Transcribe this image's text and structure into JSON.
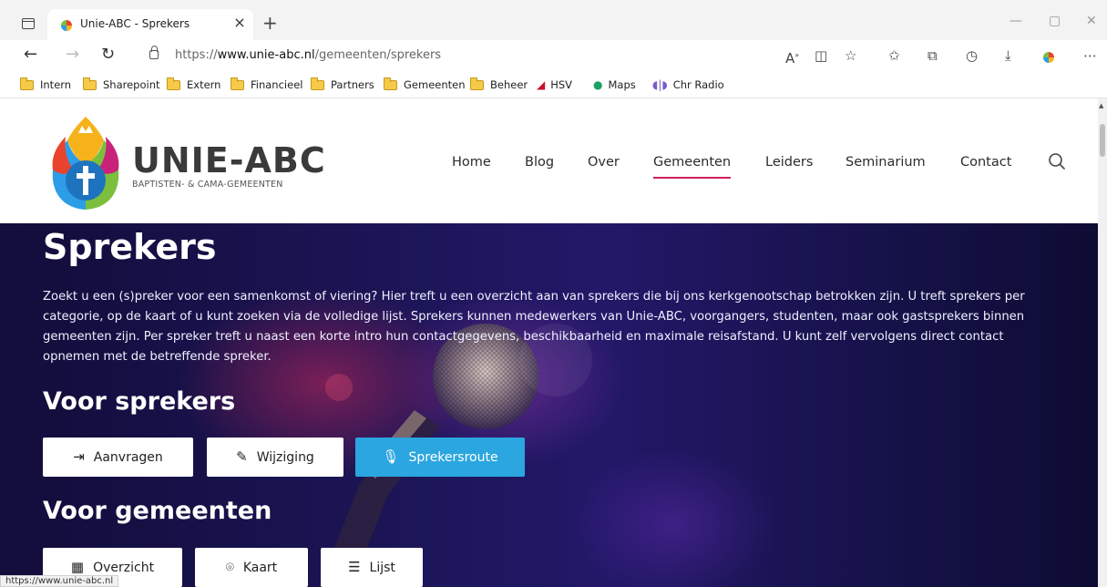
{
  "browser": {
    "tab_title": "Unie-ABC - Sprekers",
    "url_prefix": "https://",
    "url_host": "www.unie-abc.nl",
    "url_path": "/gemeenten/sprekers",
    "bookmarks": [
      {
        "label": "Intern",
        "icon": "folder-icon"
      },
      {
        "label": "Sharepoint",
        "icon": "folder-icon"
      },
      {
        "label": "Extern",
        "icon": "folder-icon"
      },
      {
        "label": "Financieel",
        "icon": "folder-icon"
      },
      {
        "label": "Partners",
        "icon": "folder-icon"
      },
      {
        "label": "Gemeenten",
        "icon": "folder-icon"
      },
      {
        "label": "Beheer",
        "icon": "folder-icon"
      },
      {
        "label": "HSV",
        "icon": "hsv-icon"
      },
      {
        "label": "Maps",
        "icon": "maps-pin-icon"
      },
      {
        "label": "Chr Radio",
        "icon": "radio-icon"
      }
    ],
    "status_url": "https://www.unie-abc.nl"
  },
  "header": {
    "brand": "UNIE-ABC",
    "brand_sub": "BAPTISTEN- & CAMA-GEMEENTEN",
    "nav": [
      {
        "label": "Home",
        "active": false
      },
      {
        "label": "Blog",
        "active": false
      },
      {
        "label": "Over",
        "active": false
      },
      {
        "label": "Gemeenten",
        "active": true
      },
      {
        "label": "Leiders",
        "active": false
      },
      {
        "label": "Seminarium",
        "active": false
      },
      {
        "label": "Contact",
        "active": false
      }
    ],
    "accent": "#d2215a"
  },
  "hero": {
    "title": "Sprekers",
    "intro": "Zoekt u een (s)preker voor een samenkomst of viering? Hier treft u een overzicht aan van sprekers die bij ons kerkgenootschap betrokken zijn. U treft sprekers per categorie, op de kaart of u kunt zoeken via de volledige lijst. Sprekers kunnen medewerkers van Unie-ABC, voorgangers, studenten, maar ook gastsprekers binnen gemeenten zijn. Per spreker treft u naast een korte intro hun contactgegevens, beschikbaarheid en maximale reisafstand. U kunt zelf vervolgens direct contact opnemen met de betreffende spreker.",
    "section_sprekers": "Voor sprekers",
    "buttons_sprekers": [
      {
        "label": "Aanvragen",
        "icon": "login-arrow-icon",
        "glyph": "⇥"
      },
      {
        "label": "Wijziging",
        "icon": "pencil-icon",
        "glyph": "✎"
      },
      {
        "label": "Sprekersroute",
        "icon": "microphone-icon",
        "glyph": "🎙"
      }
    ],
    "section_gemeenten": "Voor gemeenten",
    "buttons_gemeenten": [
      {
        "label": "Overzicht",
        "icon": "grid-icon",
        "glyph": "▦"
      },
      {
        "label": "Kaart",
        "icon": "map-pin-icon",
        "glyph": "⌾"
      },
      {
        "label": "Lijst",
        "icon": "list-icon",
        "glyph": "☰"
      }
    ],
    "button_accent": "#2ba6e0"
  }
}
